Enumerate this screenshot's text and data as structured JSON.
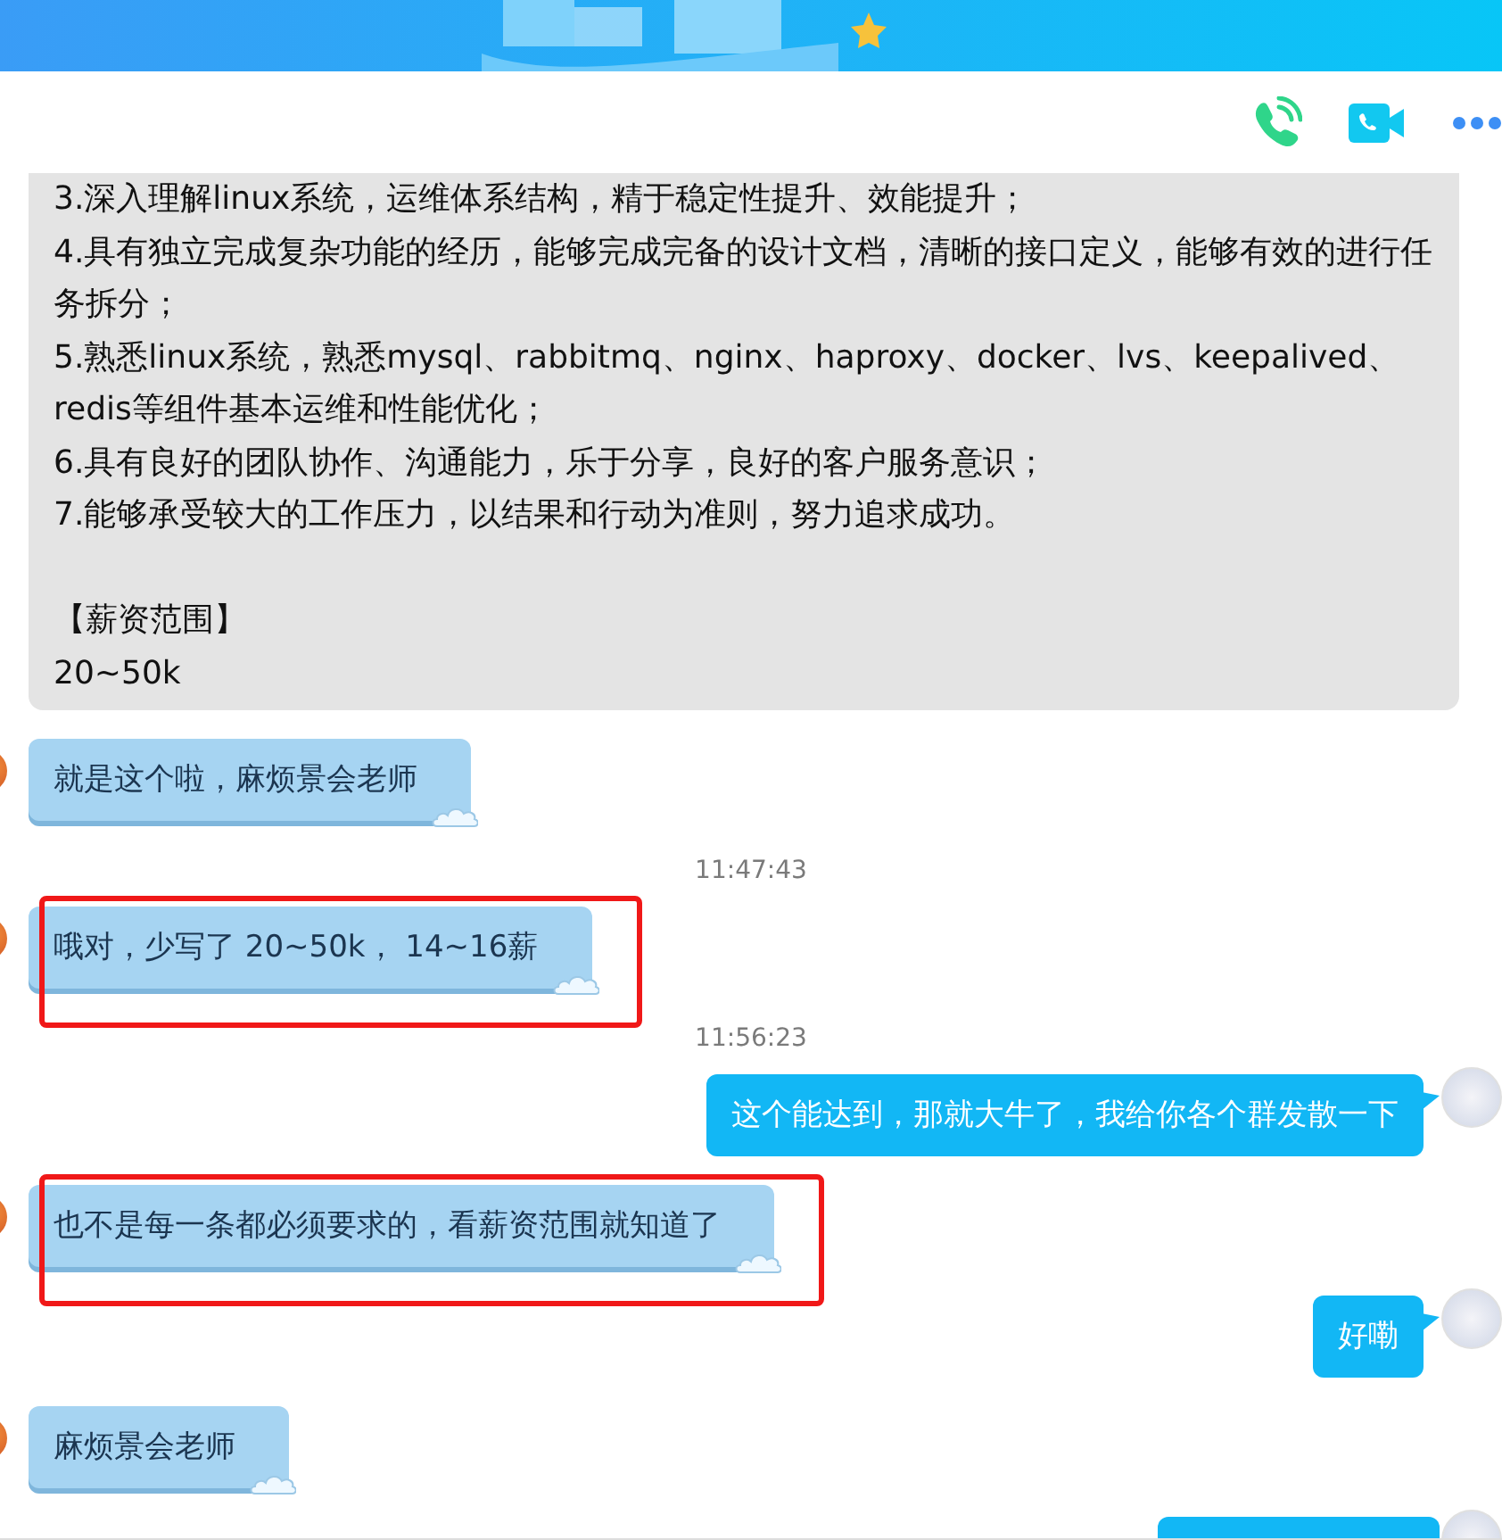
{
  "toolbar": {
    "buttons": [
      {
        "kind": "voice"
      },
      {
        "kind": "video"
      },
      {
        "kind": "more"
      }
    ]
  },
  "messages": [
    {
      "kind": "card",
      "paragraphs": [
        [
          "3.深入理解linux系统，运维体系结构，精于稳定性提升、效能提升；",
          "4.具有独立完成复杂功能的经历，能够完成完备的设计文档，清晰的接口定义，能够有效的进行任",
          "务拆分；",
          "5.熟悉linux系统，熟悉mysql、rabbitmq、nginx、haproxy、docker、lvs、keepalived、",
          "redis等组件基本运维和性能优化；",
          "6.具有良好的团队协作、沟通能力，乐于分享，良好的客户服务意识；",
          "7.能够承受较大的工作压力，以结果和行动为准则，努力追求成功。"
        ],
        [
          "【薪资范围】",
          "20~50k"
        ]
      ]
    },
    {
      "kind": "in",
      "text": "就是这个啦，麻烦景会老师",
      "highlighted": false
    },
    {
      "kind": "time",
      "text": "11:47:43"
    },
    {
      "kind": "in",
      "text": "哦对，少写了 20~50k， 14~16薪",
      "highlighted": true
    },
    {
      "kind": "time",
      "text": "11:56:23"
    },
    {
      "kind": "out",
      "text": "这个能达到，那就大牛了，我给你各个群发散一下",
      "highlighted": false
    },
    {
      "kind": "in",
      "text": "也不是每一条都必须要求的，看薪资范围就知道了",
      "highlighted": true
    },
    {
      "kind": "out",
      "text": "好嘞",
      "highlighted": false
    },
    {
      "kind": "in",
      "text": "麻烦景会老师",
      "highlighted": false
    },
    {
      "kind": "partial"
    }
  ]
}
